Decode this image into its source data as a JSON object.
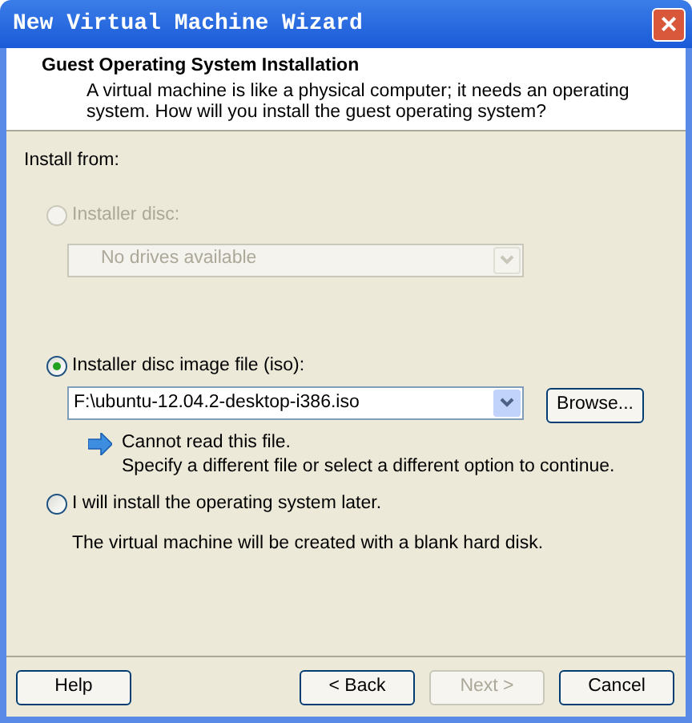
{
  "window": {
    "title": "New Virtual Machine Wizard",
    "close": "×"
  },
  "header": {
    "title": "Guest Operating System Installation",
    "description": "A virtual machine is like a physical computer; it needs an operating system. How will you install the guest operating system?"
  },
  "install_from": "Install from:",
  "options": [
    {
      "kind": "disc",
      "label": "Installer disc:",
      "selected": false,
      "disabled": true,
      "dropdown": "No drives available"
    },
    {
      "kind": "iso",
      "label": "Installer disc image file (iso):",
      "selected": true,
      "disabled": false,
      "path": "F:\\ubuntu-12.04.2-desktop-i386.iso",
      "browse": "Browse...",
      "message": [
        "Cannot read this file.",
        "Specify a different file or select a different option to continue."
      ]
    },
    {
      "kind": "later",
      "label": "I will install the operating system later.",
      "selected": false,
      "disabled": false,
      "note": "The virtual machine will be created with a blank hard disk."
    }
  ],
  "buttons": [
    {
      "label": "Help",
      "disabled": false
    },
    {
      "label": "< Back",
      "disabled": false
    },
    {
      "label": "Next >",
      "disabled": true
    },
    {
      "label": "Cancel",
      "disabled": false
    }
  ]
}
